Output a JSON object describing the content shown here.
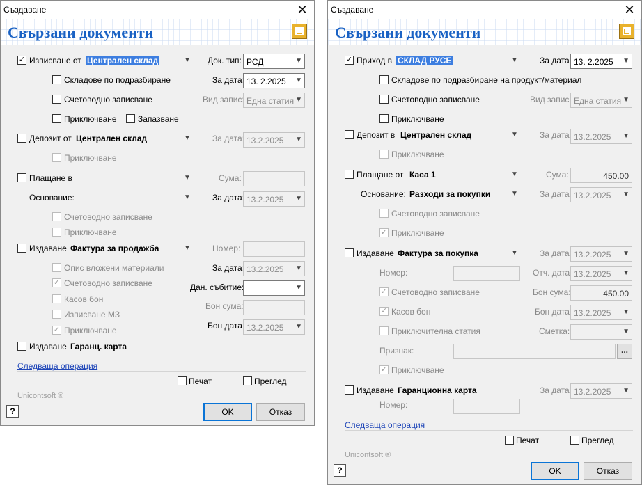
{
  "left_dialog": {
    "title": "Създаване",
    "close": "✕",
    "banner_title": "Свързани документи",
    "row_issue": {
      "check": "✓",
      "label": "Изписване от",
      "value": "Централен склад",
      "doc_type_label": "Док. тип:",
      "doc_type_value": "РСД"
    },
    "default_warehouses": "Складове по подразбиране",
    "accounting_entry": "Счетоводно записване",
    "record_type_label": "Вид запис:",
    "record_type_value": "Една статия",
    "date_label": "За дата:",
    "date_value": "13.  2.2025",
    "closing": "Приключване",
    "reserve": "Запазване",
    "deposit": {
      "label": "Депозит от",
      "value": "Централен склад",
      "date_label": "За дата:",
      "date_value": "13.2.2025",
      "closing": "Приключване"
    },
    "payment": {
      "label": "Плащане в",
      "amount_label": "Сума:",
      "basis_label": "Основание:",
      "date_label": "За дата:",
      "date_value": "13.2.2025",
      "accounting": "Счетоводно записване",
      "closing": "Приключване"
    },
    "invoice": {
      "label": "Издаване",
      "value": "Фактура за продажба",
      "number_label": "Номер:",
      "materials": "Опис вложени материали",
      "date_label": "За дата:",
      "date_value": "13.2.2025",
      "accounting": "Счетоводно записване",
      "check": "✓",
      "tax_event_label": "Дан. събитие:",
      "cash_receipt": "Касов бон",
      "receipt_amount_label": "Бон сума:",
      "issue_mz": "Изписване МЗ",
      "closing": "Приключване",
      "receipt_date_label": "Бон дата:",
      "receipt_date_value": "13.2.2025"
    },
    "warranty": {
      "label": "Издаване",
      "value": "Гаранц. карта"
    },
    "next_operation": "Следваща операция",
    "print": "Печат",
    "preview": "Преглед",
    "brand": "Unicontsoft ®",
    "help": "?",
    "ok": "OK",
    "cancel": "Отказ"
  },
  "right_dialog": {
    "title": "Създаване",
    "close": "✕",
    "banner_title": "Свързани документи",
    "row_receipt": {
      "check": "✓",
      "label": "Приход в",
      "value": "СКЛАД РУСЕ",
      "date_label": "За дата:",
      "date_value": "13.  2.2025"
    },
    "default_warehouses": "Складове по подразбиране на продукт/материал",
    "accounting_entry": "Счетоводно записване",
    "record_type_label": "Вид запис:",
    "record_type_value": "Една статия",
    "closing": "Приключване",
    "deposit": {
      "label": "Депозит в",
      "value": "Централен склад",
      "date_label": "За дата:",
      "date_value": "13.2.2025",
      "closing": "Приключване"
    },
    "payment": {
      "label": "Плащане от",
      "value": "Каса 1",
      "amount_label": "Сума:",
      "amount_value": "450.00",
      "basis_label": "Основание:",
      "basis_value": "Разходи за покупки",
      "date_label": "За дата:",
      "date_value": "13.2.2025",
      "accounting": "Счетоводно записване",
      "closing": "Приключване",
      "check": "✓"
    },
    "invoice": {
      "label": "Издаване",
      "value": "Фактура за покупка",
      "date_label": "За дата:",
      "date_value": "13.2.2025",
      "number_label": "Номер:",
      "ref_date_label": "Отч. дата:",
      "ref_date_value": "13.2.2025",
      "accounting": "Счетоводно записване",
      "receipt_amount_label": "Бон сума:",
      "receipt_amount_value": "450.00",
      "cash_receipt": "Касов бон",
      "receipt_date_label": "Бон дата:",
      "receipt_date_value": "13.2.2025",
      "closing_article": "Приключителна статия",
      "account_label": "Сметка:",
      "sign_label": "Признак:",
      "ellipsis": "...",
      "closing": "Приключване",
      "check": "✓"
    },
    "warranty": {
      "label": "Издаване",
      "value": "Гаранционна карта",
      "date_label": "За дата:",
      "date_value": "13.2.2025",
      "number_label": "Номер:"
    },
    "next_operation": "Следваща операция",
    "print": "Печат",
    "preview": "Преглед",
    "brand": "Unicontsoft ®",
    "help": "?",
    "ok": "OK",
    "cancel": "Отказ"
  }
}
